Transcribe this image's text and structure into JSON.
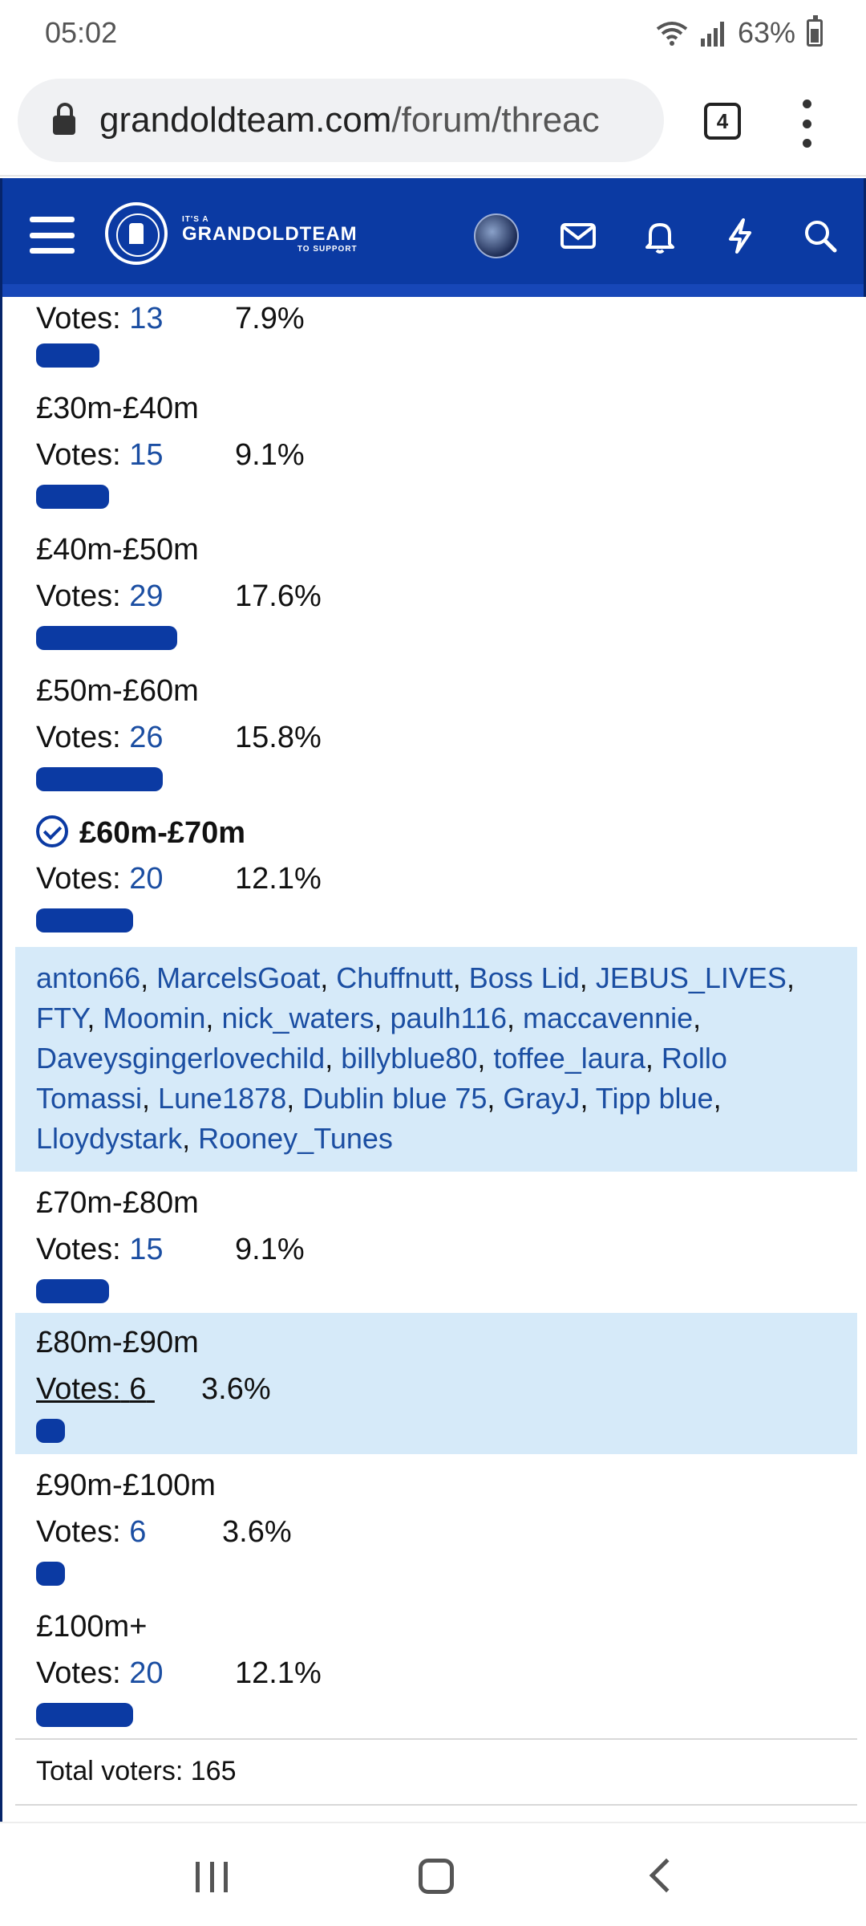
{
  "status_bar": {
    "time": "05:02",
    "battery": "63%"
  },
  "browser": {
    "url_domain": "grandoldteam.com",
    "url_path": "/forum/threac",
    "tab_count": "4"
  },
  "site_header": {
    "logo_top": "IT'S A",
    "logo_main": "GRANDOLDTEAM",
    "logo_bottom": "TO SUPPORT"
  },
  "poll": {
    "votes_label": "Votes:",
    "options": [
      {
        "label": "",
        "votes": "13",
        "percent": "7.9%",
        "fraction": 0.079
      },
      {
        "label": "£30m-£40m",
        "votes": "15",
        "percent": "9.1%",
        "fraction": 0.091
      },
      {
        "label": "£40m-£50m",
        "votes": "29",
        "percent": "17.6%",
        "fraction": 0.176
      },
      {
        "label": "£50m-£60m",
        "votes": "26",
        "percent": "15.8%",
        "fraction": 0.158
      },
      {
        "label": "£60m-£70m",
        "votes": "20",
        "percent": "12.1%",
        "fraction": 0.121,
        "selected": true
      },
      {
        "label": "£70m-£80m",
        "votes": "15",
        "percent": "9.1%",
        "fraction": 0.091
      },
      {
        "label": "£80m-£90m",
        "votes": "6",
        "percent": "3.6%",
        "fraction": 0.036
      },
      {
        "label": "£90m-£100m",
        "votes": "6",
        "percent": "3.6%",
        "fraction": 0.036
      },
      {
        "label": "£100m+",
        "votes": "20",
        "percent": "12.1%",
        "fraction": 0.121
      }
    ],
    "voters_for_selected": [
      "anton66",
      "MarcelsGoat",
      "Chuffnutt",
      "Boss Lid",
      "JEBUS_LIVES",
      "FTY",
      "Moomin",
      "nick_waters",
      "paulh116",
      "maccavennie",
      "Daveysgingerlovechild",
      "billyblue80",
      "toffee_laura",
      "Rollo Tomassi",
      "Lune1878",
      "Dublin blue 75",
      "GrayJ",
      "Tipp blue",
      "Lloydystark",
      "Rooney_Tunes"
    ],
    "total_voters": "Total voters: 165"
  },
  "colors": {
    "brand_blue": "#0b3aa3",
    "highlight": "#d6eaf9",
    "link": "#1b4ea2"
  }
}
